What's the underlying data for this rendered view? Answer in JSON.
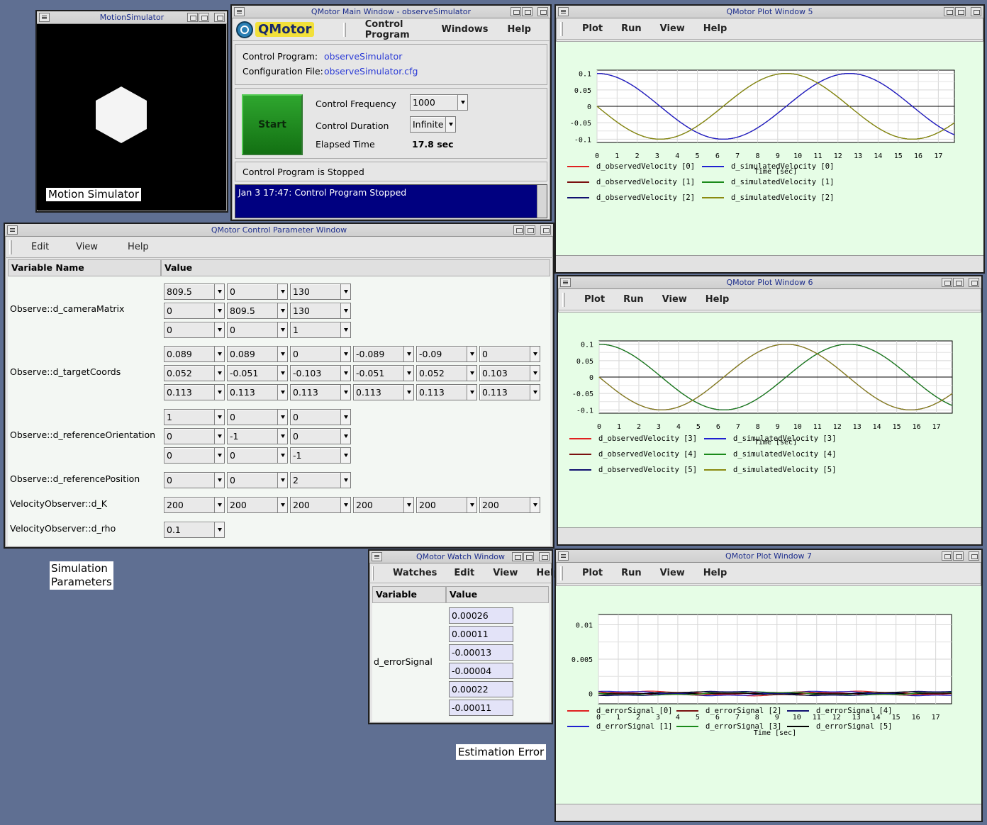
{
  "motion": {
    "title": "MotionSimulator",
    "caption": "Motion Simulator"
  },
  "captions": {
    "simulation": "Simulation Parameters",
    "estimation": "Estimation Error"
  },
  "main": {
    "title": "QMotor Main Window - observeSimulator",
    "logo": "QMotor",
    "menu": [
      "Control Program",
      "Windows",
      "Help"
    ],
    "control_program_label": "Control Program:",
    "control_program": "observeSimulator",
    "config_label": "Configuration File:",
    "config_file": "observeSimulator.cfg",
    "start": "Start",
    "freq_label": "Control Frequency",
    "freq": "1000",
    "duration_label": "Control Duration",
    "duration": "Infinite",
    "elapsed_label": "Elapsed Time",
    "elapsed": "17.8 sec",
    "status": "Control Program is Stopped",
    "log": "Jan  3 17:47:  Control Program Stopped",
    "log_bg": "#000080",
    "start_color": "#1f8f1f"
  },
  "param": {
    "title": "QMotor Control Parameter Window",
    "menu": [
      "Edit",
      "View",
      "Help"
    ],
    "col_name": "Variable Name",
    "col_value": "Value",
    "vars": [
      {
        "name": "Observe::d_cameraMatrix",
        "rows": [
          [
            "809.5",
            "0",
            "130"
          ],
          [
            "0",
            "809.5",
            "130"
          ],
          [
            "0",
            "0",
            "1"
          ]
        ]
      },
      {
        "name": "Observe::d_targetCoords",
        "rows": [
          [
            "0.089",
            "0.089",
            "0",
            "-0.089",
            "-0.09",
            "0"
          ],
          [
            "0.052",
            "-0.051",
            "-0.103",
            "-0.051",
            "0.052",
            "0.103"
          ],
          [
            "0.113",
            "0.113",
            "0.113",
            "0.113",
            "0.113",
            "0.113"
          ]
        ]
      },
      {
        "name": "Observe::d_referenceOrientation",
        "rows": [
          [
            "1",
            "0",
            "0"
          ],
          [
            "0",
            "-1",
            "0"
          ],
          [
            "0",
            "0",
            "-1"
          ]
        ]
      },
      {
        "name": "Observe::d_referencePosition",
        "rows": [
          [
            "0",
            "0",
            "2"
          ]
        ]
      },
      {
        "name": "VelocityObserver::d_K",
        "rows": [
          [
            "200",
            "200",
            "200",
            "200",
            "200",
            "200"
          ]
        ]
      },
      {
        "name": "VelocityObserver::d_rho",
        "rows": [
          [
            "0.1"
          ]
        ]
      }
    ]
  },
  "watch": {
    "title": "QMotor Watch Window",
    "menu": [
      "Watches",
      "Edit",
      "View",
      "Help"
    ],
    "col_name": "Variable Name",
    "col_value": "Value",
    "var": "d_errorSignal",
    "values": [
      "0.00026",
      "0.00011",
      "-0.00013",
      "-0.00004",
      "0.00022",
      "-0.00011"
    ]
  },
  "plots": [
    {
      "title": "QMotor Plot Window 5",
      "menu": [
        "Plot",
        "Run",
        "View",
        "Help"
      ],
      "chart_data": {
        "type": "line",
        "xlabel": "Time [sec]",
        "xlim": [
          0,
          17.8
        ],
        "ylim": [
          -0.11,
          0.11
        ],
        "yticks": [
          "0.1",
          "0.05",
          "0",
          "-0.05",
          "-0.1"
        ],
        "ytick_values": [
          0.1,
          0.05,
          0,
          -0.05,
          -0.1
        ],
        "xticks": [
          "0",
          "1",
          "2",
          "3",
          "4",
          "5",
          "6",
          "7",
          "8",
          "9",
          "10",
          "11",
          "12",
          "13",
          "14",
          "15",
          "16",
          "17"
        ],
        "series": [
          {
            "name": "d_observedVelocity [0]",
            "color": "#e02020",
            "amp": 0.1,
            "phase": 1.571,
            "freq": 0.5
          },
          {
            "name": "d_observedVelocity [1]",
            "color": "#7a1010",
            "amp": 0.1,
            "phase": 0,
            "freq": 0.5
          },
          {
            "name": "d_observedVelocity [2]",
            "color": "#101070",
            "amp": 0.1,
            "phase": 0,
            "freq": 0.5
          },
          {
            "name": "d_simulatedVelocity [0]",
            "color": "#2020d0",
            "amp": 0.1,
            "phase": 0,
            "freq": 0.5
          },
          {
            "name": "d_simulatedVelocity [1]",
            "color": "#1a8a1a",
            "amp": 0.1,
            "phase": 1.571,
            "freq": 0.5
          },
          {
            "name": "d_simulatedVelocity [2]",
            "color": "#8a8a10",
            "amp": 0.1,
            "phase": 1.571,
            "freq": 0.5
          }
        ]
      }
    },
    {
      "title": "QMotor Plot Window 6",
      "menu": [
        "Plot",
        "Run",
        "View",
        "Help"
      ],
      "chart_data": {
        "type": "line",
        "xlabel": "Time [sec]",
        "xlim": [
          0,
          17.8
        ],
        "ylim": [
          -0.11,
          0.11
        ],
        "yticks": [
          "0.1",
          "0.05",
          "0",
          "-0.05",
          "-0.1"
        ],
        "ytick_values": [
          0.1,
          0.05,
          0,
          -0.05,
          -0.1
        ],
        "xticks": [
          "0",
          "1",
          "2",
          "3",
          "4",
          "5",
          "6",
          "7",
          "8",
          "9",
          "10",
          "11",
          "12",
          "13",
          "14",
          "15",
          "16",
          "17"
        ],
        "series": [
          {
            "name": "d_observedVelocity [3]",
            "color": "#e02020",
            "amp": 0.1,
            "phase": 1.571,
            "freq": 0.5
          },
          {
            "name": "d_observedVelocity [4]",
            "color": "#7a1010",
            "amp": 0.1,
            "phase": 0,
            "freq": 0.5
          },
          {
            "name": "d_observedVelocity [5]",
            "color": "#101070",
            "amp": 0.1,
            "phase": 0,
            "freq": 0.5
          },
          {
            "name": "d_simulatedVelocity [3]",
            "color": "#2020d0",
            "amp": 0.1,
            "phase": 1.571,
            "freq": 0.5
          },
          {
            "name": "d_simulatedVelocity [4]",
            "color": "#1a8a1a",
            "amp": 0.1,
            "phase": 0,
            "freq": 0.5
          },
          {
            "name": "d_simulatedVelocity [5]",
            "color": "#8a8a10",
            "amp": 0.1,
            "phase": 1.571,
            "freq": 0.5
          }
        ]
      }
    },
    {
      "title": "QMotor Plot Window 7",
      "menu": [
        "Plot",
        "Run",
        "View",
        "Help"
      ],
      "chart_data": {
        "type": "line",
        "xlabel": "Time [sec]",
        "xlim": [
          0,
          17.8
        ],
        "ylim": [
          -0.0015,
          0.0115
        ],
        "yticks": [
          "0.01",
          "0.005",
          "0"
        ],
        "ytick_values": [
          0.01,
          0.005,
          0
        ],
        "xticks": [
          "0",
          "1",
          "2",
          "3",
          "4",
          "5",
          "6",
          "7",
          "8",
          "9",
          "10",
          "11",
          "12",
          "13",
          "14",
          "15",
          "16",
          "17"
        ],
        "series": [
          {
            "name": "d_errorSignal [0]",
            "color": "#e02020",
            "amp": 0.0003,
            "phase": 0,
            "freq": 0.5
          },
          {
            "name": "d_errorSignal [1]",
            "color": "#2020d0",
            "amp": 0.0003,
            "phase": 1,
            "freq": 0.5
          },
          {
            "name": "d_errorSignal [2]",
            "color": "#7a1010",
            "amp": 0.0002,
            "phase": 2,
            "freq": 0.5
          },
          {
            "name": "d_errorSignal [3]",
            "color": "#1a8a1a",
            "amp": 0.0002,
            "phase": 3,
            "freq": 0.5
          },
          {
            "name": "d_errorSignal [4]",
            "color": "#101070",
            "amp": 0.0003,
            "phase": 4,
            "freq": 0.5
          },
          {
            "name": "d_errorSignal [5]",
            "color": "#000000",
            "amp": 0.0002,
            "phase": 5,
            "freq": 0.5
          }
        ]
      }
    }
  ]
}
